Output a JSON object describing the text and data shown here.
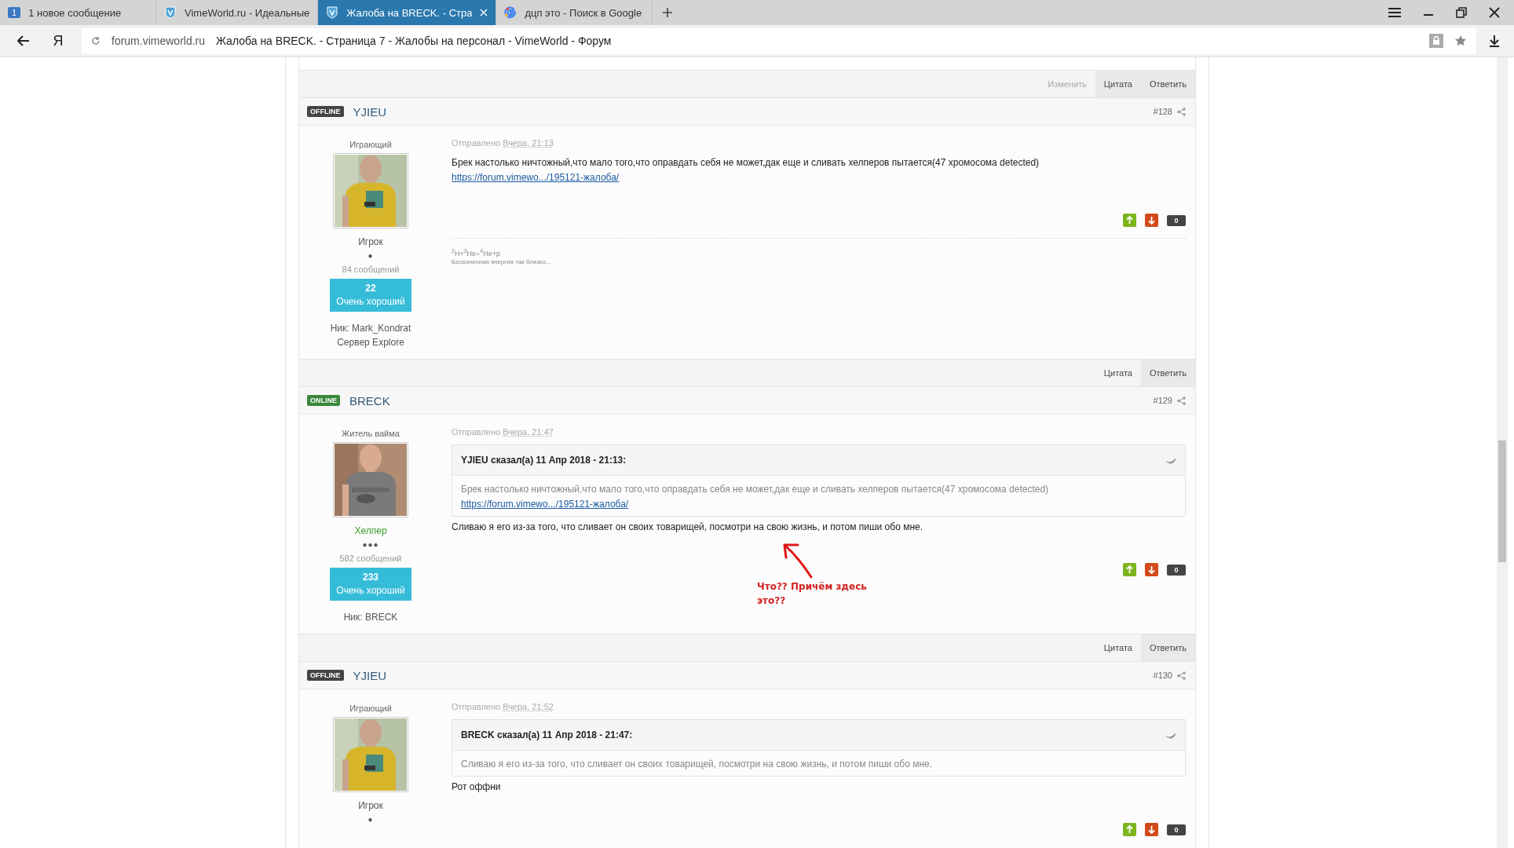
{
  "browser": {
    "tabs": [
      {
        "label": "1 новое сообщение",
        "kind": "notification",
        "badge": "1",
        "selected": false
      },
      {
        "label": "VimeWorld.ru - Идеальные",
        "kind": "site",
        "selected": false
      },
      {
        "label": "Жалоба на BRECK. - Стра",
        "kind": "site",
        "selected": true
      },
      {
        "label": "дцп это - Поиск в Google",
        "kind": "search",
        "selected": false
      }
    ],
    "yandex": "Я",
    "domain": "forum.vimeworld.ru",
    "page_title": "Жалоба на BRECK. - Страница 7 - Жалобы на персонал - VimeWorld - Форум"
  },
  "feed": [
    {
      "kind": "actions",
      "buttons": [
        {
          "label": "Изменить",
          "disabled": true
        },
        {
          "label": "Цитата",
          "disabled": false
        },
        {
          "label": "Ответить",
          "disabled": false
        }
      ]
    },
    {
      "kind": "post",
      "status": "OFFLINE",
      "online": false,
      "author": "YJIEU",
      "number": "#128",
      "group": "Играющий",
      "rank": "Игрок",
      "staff": false,
      "pips": "●",
      "posts_count": "84 сообщений",
      "rep_value": "22",
      "rep_label": "Очень хороший",
      "info": [
        "Ник: Mark_Kondrat",
        "Сервер Explore"
      ],
      "sent_label": "Отправлено",
      "sent_time": "Вчера, 21:13",
      "body": [
        {
          "kind": "text",
          "text": "Брек настолько ничтожный,что мало того,что оправдать себя не может,дак еще и сливать хелперов пытается(47 хромосома detected)"
        },
        {
          "kind": "link",
          "text": "https://forum.vimewo.../195121-жалоба/"
        }
      ],
      "votes": "0",
      "signature": [
        "$^{2}$H+$^{3}$He=$^{4}$He+p",
        "Бесконечная энергия так близко..."
      ]
    },
    {
      "kind": "actions",
      "buttons": [
        {
          "label": "Цитата",
          "disabled": false
        },
        {
          "label": "Ответить",
          "disabled": false
        }
      ]
    },
    {
      "kind": "post",
      "status": "ONLINE",
      "online": true,
      "author": "BRECK",
      "number": "#129",
      "group": "Житель вайма",
      "rank": "Хелпер",
      "staff": true,
      "pips": "●●●",
      "posts_count": "582 сообщений",
      "rep_value": "233",
      "rep_label": "Очень хороший",
      "info": [
        "Ник: BRECK"
      ],
      "sent_label": "Отправлено",
      "sent_time": "Вчера, 21:47",
      "quote": {
        "header": "YJIEU сказал(а) 11 Апр 2018 - 21:13:",
        "body": [
          {
            "kind": "text",
            "text": "Брек настолько ничтожный,что мало того,что оправдать себя не может,дак еще и сливать хелперов пытается(47 хромосома detected)"
          },
          {
            "kind": "link",
            "text": "https://forum.vimewo.../195121-жалоба/"
          }
        ]
      },
      "body": [
        {
          "kind": "text",
          "text": "Сливаю я его из-за того, что сливает он своих товарищей, посмотри на свою жизнь, и потом пиши обо мне."
        }
      ],
      "votes": "0"
    },
    {
      "kind": "actions",
      "buttons": [
        {
          "label": "Цитата",
          "disabled": false
        },
        {
          "label": "Ответить",
          "disabled": false
        }
      ]
    },
    {
      "kind": "post",
      "status": "OFFLINE",
      "online": false,
      "author": "YJIEU",
      "number": "#130",
      "group": "Играющий",
      "rank": "Игрок",
      "staff": false,
      "pips": "●",
      "sent_label": "Отправлено",
      "sent_time": "Вчера, 21:52",
      "quote": {
        "header": "BRECK сказал(а) 11 Апр 2018 - 21:47:",
        "body": [
          {
            "kind": "text",
            "text": "Сливаю я его из-за того, что сливает он своих товарищей, посмотри на свою жизнь, и потом пиши обо мне."
          }
        ]
      },
      "body": [
        {
          "kind": "text",
          "text": "Рот оффни"
        }
      ],
      "votes": "0"
    }
  ],
  "annotation": {
    "text": "Что?? Причём здесь это??"
  }
}
